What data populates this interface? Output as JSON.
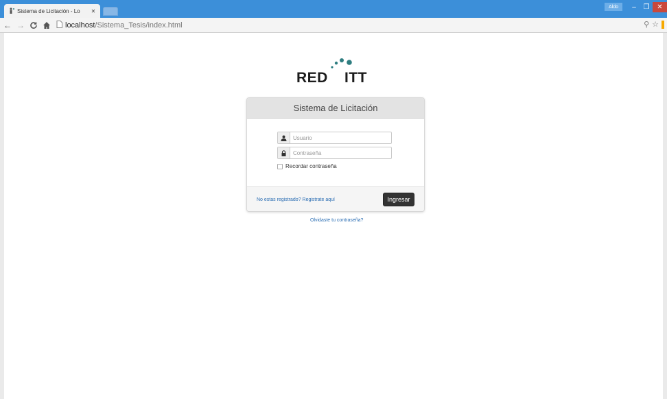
{
  "browser": {
    "tab_title": "Sistema de Licitación - Lo",
    "user_badge": "Aldo",
    "url_host": "localhost",
    "url_path": "/Sistema_Tesis/index.html"
  },
  "logo": {
    "left_text": "RED",
    "right_text": "ITT",
    "dot_color": "#2e7d80"
  },
  "login": {
    "title": "Sistema de Licitación",
    "username_placeholder": "Usuario",
    "password_placeholder": "Contraseña",
    "remember_label": "Recordar contraseña",
    "register_link": "No estas registrado? Registrate aquí",
    "submit_label": "Ingresar"
  },
  "forgot_link": "Olvidaste tu contraseña?",
  "colors": {
    "titlebar": "#3c8fd9",
    "link": "#2a6db3",
    "button": "#333333"
  }
}
